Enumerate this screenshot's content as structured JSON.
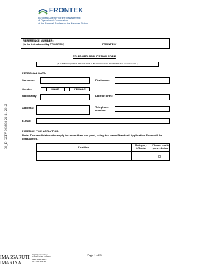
{
  "header": {
    "brand": "FRONTEX",
    "agency_lines": [
      "European Agency for the Management",
      "of Operational Cooperation",
      "at the External Borders of the Member States"
    ],
    "colors": {
      "brand_blue": "#1b4f8c",
      "brand_green": "#4b9a3f"
    }
  },
  "reference": {
    "label": "REFERENCE NUMBER:",
    "note": "(to be introduced by FRONTEX)",
    "frontex_prefix": "FRONTEX/"
  },
  "form": {
    "title": "STANDARD APPLICATION FORM",
    "instruction": "[ALL THE REQUIRED FIELDS SHALL BE FILLED IN ELECTRONICALLY IN ENGLISH]"
  },
  "personal": {
    "heading": "PERSONAL DATA:",
    "surname": "Surname:",
    "first_name": "First name:",
    "gender": "Gender:",
    "male": "MALE",
    "female": "FEMALE",
    "nationality": "Nationality:",
    "dob": "Date of birth:",
    "address": "Address:",
    "telephone_l1": "Telephone",
    "telephone_l2": "number:",
    "email": "E-mail:"
  },
  "position": {
    "heading": "POSITION YOU APPLY FOR:",
    "note": "Note: The candidates who apply for more than one post, using the same Standard Application Form will be disqualified.",
    "col_position": "Position",
    "col_category_l1": "Category",
    "col_category_l2": "/ Grade",
    "col_mark_l1": "Please mark",
    "col_mark_l2": "your choice"
  },
  "side_stamp": "30_D GCIV 003803 29-11-2012",
  "footer": {
    "page": "Page 1 of 6",
    "signer_l1": "IMASSARUTI",
    "signer_l2": "IMARINA",
    "sig_lines": [
      "Digitally signed by",
      "MASSARUTI MARINA",
      "Date: 2012.11.29",
      "10:27:58 +01'00'"
    ]
  }
}
